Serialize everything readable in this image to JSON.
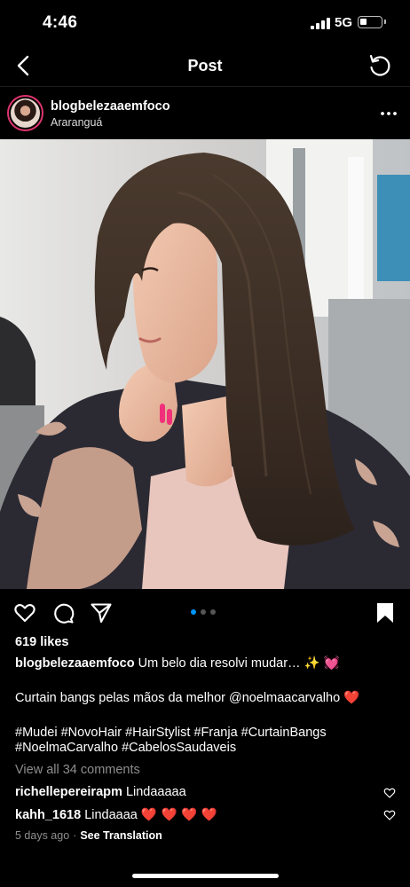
{
  "status_bar": {
    "time": "4:46",
    "network": "5G",
    "battery_level": 0.3
  },
  "nav": {
    "title": "Post",
    "back_icon": "chevron-left-icon",
    "refresh_icon": "refresh-icon"
  },
  "author": {
    "username": "blogbelezaaemfoco",
    "location": "Araranguá"
  },
  "actions": {
    "like_icon": "heart-icon",
    "comment_icon": "comment-icon",
    "share_icon": "send-icon",
    "save_icon": "bookmark-icon",
    "carousel_total": 3,
    "carousel_active": 1
  },
  "likes": "619 likes",
  "caption": {
    "username": "blogbelezaaemfoco",
    "text": "Um belo dia resolvi mudar…",
    "emoji": "✨",
    "emoji2": "💓",
    "line2": "Curtain bangs pelas mãos da melhor @noelmaacarvalho",
    "line2_emoji": "❤️",
    "hashtags_line1": "#Mudei #NovoHair #HairStylist #Franja #CurtainBangs",
    "hashtags_line2": "#NoelmaCarvalho #CabelosSaudaveis"
  },
  "view_comments": "View all 34 comments",
  "comments": [
    {
      "username": "richellepereirapm",
      "text": "Lindaaaaa"
    },
    {
      "username": "kahh_1618",
      "text": "Lindaaaa",
      "emoji": "❤️ ❤️ ❤️ ❤️"
    }
  ],
  "meta": {
    "ago": "5 days ago",
    "separator": "·",
    "translate": "See Translation"
  },
  "colors": {
    "background": "#000000",
    "accent_blue": "#0095f6",
    "muted": "#8e8e8e",
    "heart_red": "#e0243a"
  }
}
